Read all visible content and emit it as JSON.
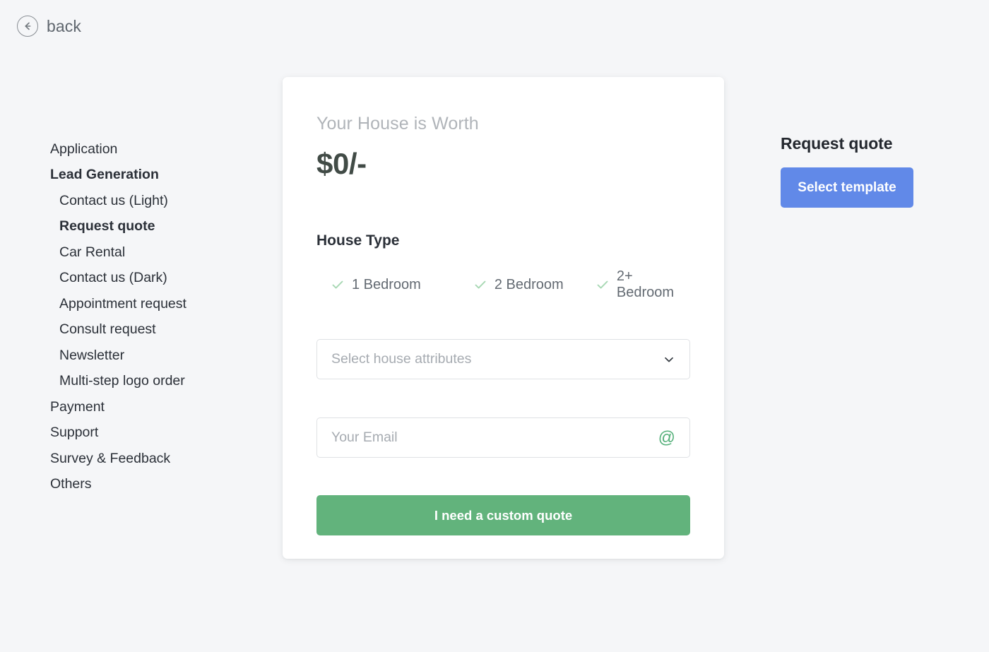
{
  "back": {
    "label": "back",
    "icon": "arrow-left-circle-icon"
  },
  "sidebar": {
    "items": [
      {
        "label": "Application",
        "level": "top",
        "bold": false
      },
      {
        "label": "Lead Generation",
        "level": "top",
        "bold": true
      },
      {
        "label": "Contact us (Light)",
        "level": "child",
        "bold": false
      },
      {
        "label": "Request quote",
        "level": "child",
        "bold": true
      },
      {
        "label": "Car Rental",
        "level": "child",
        "bold": false
      },
      {
        "label": "Contact us (Dark)",
        "level": "child",
        "bold": false
      },
      {
        "label": "Appointment request",
        "level": "child",
        "bold": false
      },
      {
        "label": "Consult request",
        "level": "child",
        "bold": false
      },
      {
        "label": "Newsletter",
        "level": "child",
        "bold": false
      },
      {
        "label": "Multi-step logo order",
        "level": "child",
        "bold": false
      },
      {
        "label": "Payment",
        "level": "top",
        "bold": false
      },
      {
        "label": "Support",
        "level": "top",
        "bold": false
      },
      {
        "label": "Survey & Feedback",
        "level": "top",
        "bold": false
      },
      {
        "label": "Others",
        "level": "top",
        "bold": false
      }
    ]
  },
  "card": {
    "worth_label": "Your House is Worth",
    "worth_value": "$0/-",
    "house_type_title": "House Type",
    "house_types": [
      {
        "label": "1 Bedroom",
        "icon": "check-icon"
      },
      {
        "label": "2 Bedroom",
        "icon": "check-icon"
      },
      {
        "label": "2+ Bedroom",
        "icon": "check-icon"
      }
    ],
    "attributes_select": {
      "placeholder": "Select house attributes",
      "value": "",
      "icon": "chevron-down-icon"
    },
    "email_input": {
      "placeholder": "Your Email",
      "value": "",
      "icon": "at-icon",
      "icon_glyph": "@"
    },
    "submit_label": "I need a custom quote"
  },
  "right_panel": {
    "title": "Request quote",
    "select_template_label": "Select template"
  },
  "colors": {
    "page_background": "#f5f6f8",
    "card_background": "#ffffff",
    "accent_green": "#62b37c",
    "accent_blue": "#6189e8",
    "check_green": "#a8d8b4",
    "at_green": "#55b07a",
    "text_dark": "#2b3038",
    "text_muted": "#a6abb1",
    "price_text": "#414b46"
  }
}
